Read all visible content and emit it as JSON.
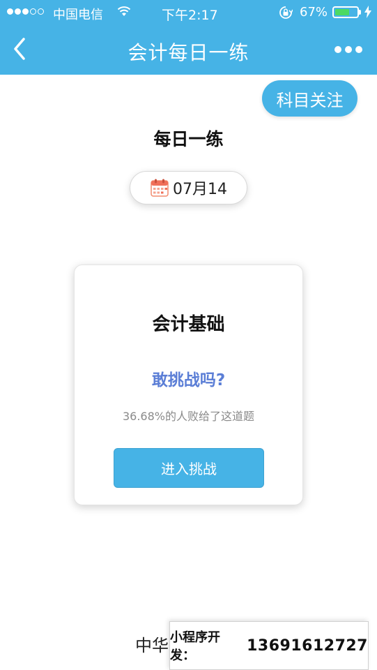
{
  "status_bar": {
    "carrier": "中国电信",
    "time": "下午2:17",
    "battery_percent": "67%",
    "battery_level": 0.67
  },
  "nav": {
    "title": "会计每日一练",
    "back_icon": "chevron-left-icon",
    "more_icon": "more-dots-icon"
  },
  "follow_button": {
    "label": "科目关注"
  },
  "page_title": "每日一练",
  "date": {
    "icon": "calendar-icon",
    "text": "07月14"
  },
  "card": {
    "subject": "会计基础",
    "dare": "敢挑战吗?",
    "fail_rate": "36.68%的人败给了这道题",
    "button": "进入挑战"
  },
  "footer": {
    "partial_text": "中华"
  },
  "dev_banner": {
    "label": "小程序开发：",
    "phone": "13691612727"
  },
  "colors": {
    "primary": "#46b3e6",
    "dare": "#5b7ed6",
    "battery": "#4cd964"
  }
}
